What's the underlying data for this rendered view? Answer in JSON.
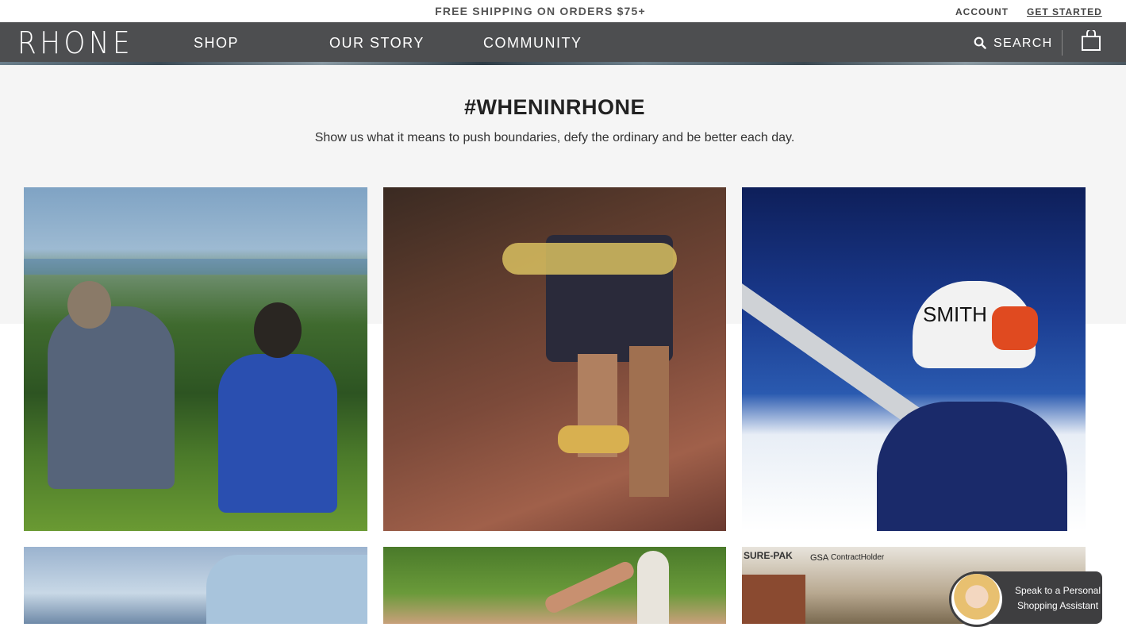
{
  "promo": {
    "text": "FREE SHIPPING ON ORDERS $75+"
  },
  "utility": {
    "account": "ACCOUNT",
    "get_started": "GET STARTED"
  },
  "nav": {
    "logo": "RHONE",
    "links": [
      "SHOP",
      "OUR STORY",
      "COMMUNITY"
    ],
    "search_label": "SEARCH"
  },
  "hero": {
    "title": "#WHENINRHONE",
    "subtitle": "Show us what it means to push boundaries, defy the ordinary and be better each day."
  },
  "photos": [
    {
      "subject": "two men sitting on grassy hill overlooking valley"
    },
    {
      "subject": "climber wearing climbing shoes and harness"
    },
    {
      "subject": "skier with Smith helmet carrying skis"
    },
    {
      "subject": "glacier ice climbing"
    },
    {
      "subject": "person holding surfboard"
    },
    {
      "subject": "storage building sign"
    }
  ],
  "photo_text": {
    "helmet_brand": "SMITH",
    "sign_left": "GSA",
    "sign_right": "ContractHolder",
    "sign_top": "SURE-PAK"
  },
  "chat": {
    "label": "Speak to a Personal Shopping Assistant"
  },
  "colors": {
    "nav_bg": "#4d4e50",
    "hero_bg": "#f5f5f5",
    "chat_bg": "#3e3e40"
  }
}
